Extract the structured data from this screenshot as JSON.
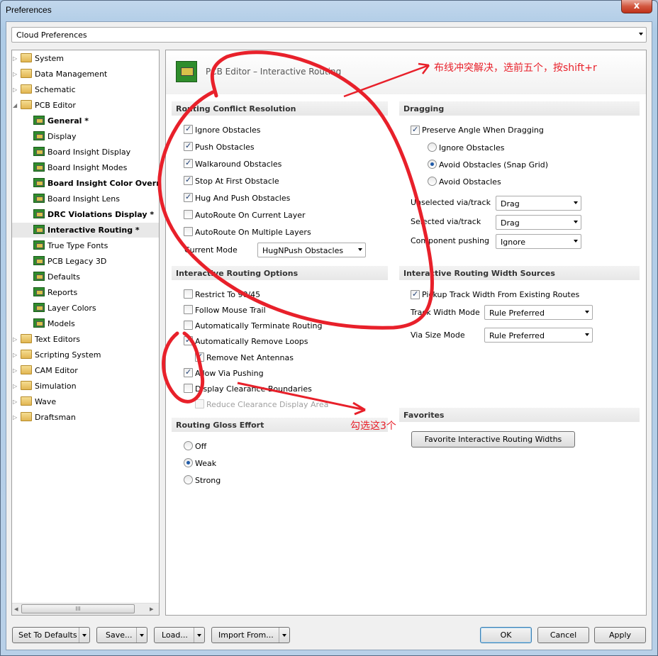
{
  "window": {
    "title": "Preferences",
    "close_glyph": "x"
  },
  "preferences_source": {
    "value": "Cloud Preferences"
  },
  "tree": [
    {
      "label": "System",
      "icon": "folder-icon",
      "level": 0,
      "bold": false
    },
    {
      "label": "Data Management",
      "icon": "folder-icon",
      "level": 0,
      "bold": false
    },
    {
      "label": "Schematic",
      "icon": "folder-icon",
      "level": 0,
      "bold": false
    },
    {
      "label": "PCB Editor",
      "icon": "open-folder-icon",
      "level": 0,
      "bold": false
    },
    {
      "label": "General *",
      "icon": "pcb-icon",
      "level": 1,
      "bold": true
    },
    {
      "label": "Display",
      "icon": "pcb-icon",
      "level": 1,
      "bold": false
    },
    {
      "label": "Board Insight Display",
      "icon": "pcb-icon",
      "level": 1,
      "bold": false
    },
    {
      "label": "Board Insight Modes",
      "icon": "pcb-icon",
      "level": 1,
      "bold": false
    },
    {
      "label": "Board Insight Color Overrides",
      "icon": "pcb-icon",
      "level": 1,
      "bold": true
    },
    {
      "label": "Board Insight Lens",
      "icon": "pcb-icon",
      "level": 1,
      "bold": false
    },
    {
      "label": "DRC Violations Display *",
      "icon": "pcb-icon",
      "level": 1,
      "bold": true
    },
    {
      "label": "Interactive Routing *",
      "icon": "pcb-icon",
      "level": 1,
      "bold": true
    },
    {
      "label": "True Type Fonts",
      "icon": "pcb-icon",
      "level": 1,
      "bold": false
    },
    {
      "label": "PCB Legacy 3D",
      "icon": "pcb-icon",
      "level": 1,
      "bold": false
    },
    {
      "label": "Defaults",
      "icon": "pcb-icon",
      "level": 1,
      "bold": false
    },
    {
      "label": "Reports",
      "icon": "pcb-icon",
      "level": 1,
      "bold": false
    },
    {
      "label": "Layer Colors",
      "icon": "pcb-icon",
      "level": 1,
      "bold": false
    },
    {
      "label": "Models",
      "icon": "pcb-icon",
      "level": 1,
      "bold": false
    },
    {
      "label": "Text Editors",
      "icon": "folder-icon",
      "level": 0,
      "bold": false
    },
    {
      "label": "Scripting System",
      "icon": "folder-icon",
      "level": 0,
      "bold": false
    },
    {
      "label": "CAM Editor",
      "icon": "folder-icon",
      "level": 0,
      "bold": false
    },
    {
      "label": "Simulation",
      "icon": "folder-icon",
      "level": 0,
      "bold": false
    },
    {
      "label": "Wave",
      "icon": "folder-icon",
      "level": 0,
      "bold": false
    },
    {
      "label": "Draftsman",
      "icon": "folder-icon",
      "level": 0,
      "bold": false
    }
  ],
  "selected_tree_item": "Interactive Routing *",
  "tree_scroll": {
    "thumb_glyph": "III",
    "left_arrow": "◂",
    "right_arrow": "▸"
  },
  "page": {
    "title": "PCB Editor – Interactive Routing"
  },
  "conflict": {
    "title": "Routing Conflict Resolution",
    "options": [
      {
        "label": "Ignore Obstacles",
        "checked": true
      },
      {
        "label": "Push Obstacles",
        "checked": true
      },
      {
        "label": "Walkaround Obstacles",
        "checked": true
      },
      {
        "label": "Stop At First Obstacle",
        "checked": true
      },
      {
        "label": "Hug And Push Obstacles",
        "checked": true
      },
      {
        "label": "AutoRoute On Current Layer",
        "checked": false
      },
      {
        "label": "AutoRoute On Multiple Layers",
        "checked": false
      }
    ],
    "current_mode_label": "Current Mode",
    "current_mode_value": "HugNPush Obstacles"
  },
  "options_section": {
    "title": "Interactive Routing Options",
    "items": [
      {
        "label": "Restrict To 90/45",
        "checked": false,
        "disabled": false,
        "indent": false
      },
      {
        "label": "Follow Mouse Trail",
        "checked": false,
        "disabled": false,
        "indent": false
      },
      {
        "label": "Automatically Terminate Routing",
        "checked": false,
        "disabled": false,
        "indent": false
      },
      {
        "label": "Automatically Remove Loops",
        "checked": true,
        "disabled": false,
        "indent": false
      },
      {
        "label": "Remove Net Antennas",
        "checked": true,
        "disabled": false,
        "indent": true
      },
      {
        "label": "Allow Via Pushing",
        "checked": true,
        "disabled": false,
        "indent": false
      },
      {
        "label": "Display Clearance Boundaries",
        "checked": false,
        "disabled": false,
        "indent": false
      },
      {
        "label": "Reduce Clearance Display Area",
        "checked": false,
        "disabled": true,
        "indent": true
      }
    ]
  },
  "gloss": {
    "title": "Routing Gloss Effort",
    "options": [
      {
        "label": "Off",
        "selected": false
      },
      {
        "label": "Weak",
        "selected": true
      },
      {
        "label": "Strong",
        "selected": false
      }
    ]
  },
  "dragging": {
    "title": "Dragging",
    "preserve_angle": {
      "label": "Preserve Angle When Dragging",
      "checked": true
    },
    "radios": [
      {
        "label": "Ignore Obstacles",
        "selected": false
      },
      {
        "label": "Avoid Obstacles (Snap Grid)",
        "selected": true
      },
      {
        "label": "Avoid Obstacles",
        "selected": false
      }
    ],
    "rows": [
      {
        "label": "Unselected via/track",
        "value": "Drag"
      },
      {
        "label": "Selected via/track",
        "value": "Drag"
      },
      {
        "label": "Component pushing",
        "value": "Ignore"
      }
    ]
  },
  "width_sources": {
    "title": "Interactive Routing Width Sources",
    "pickup": {
      "label": "Pickup Track Width From Existing Routes",
      "checked": true
    },
    "rows": [
      {
        "label": "Track Width Mode",
        "value": "Rule Preferred"
      },
      {
        "label": "Via Size Mode",
        "value": "Rule Preferred"
      }
    ]
  },
  "favorites": {
    "title": "Favorites",
    "button": "Favorite Interactive Routing Widths"
  },
  "footer": {
    "set_defaults": "Set To Defaults",
    "save": "Save...",
    "load": "Load...",
    "import": "Import From...",
    "ok": "OK",
    "cancel": "Cancel",
    "apply": "Apply"
  },
  "annotations": {
    "top": "布线冲突解决，选前五个，按shift+r",
    "bottom": "勾选这3个"
  },
  "annotation_color": "#e8202a"
}
